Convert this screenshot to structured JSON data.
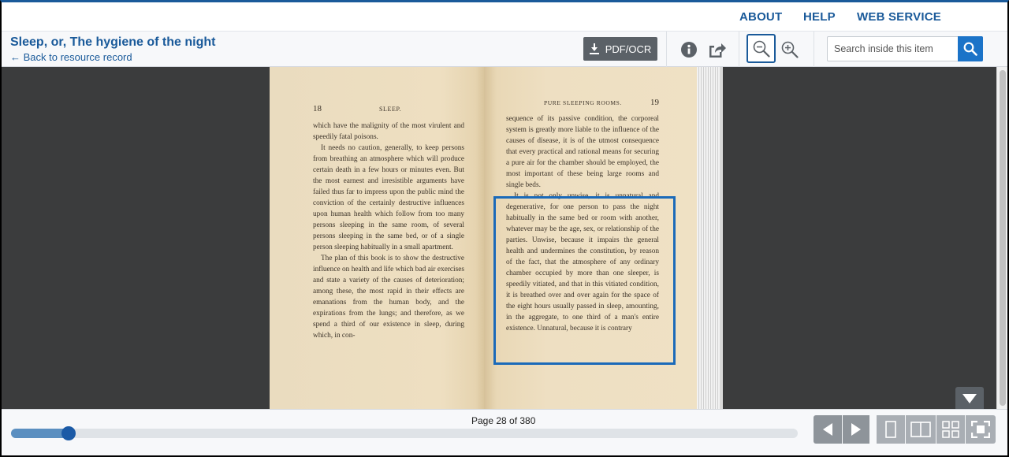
{
  "nav": {
    "about": "ABOUT",
    "help": "HELP",
    "web_service": "WEB SERVICE"
  },
  "header": {
    "title": "Sleep, or, The hygiene of the night",
    "back_link": "← Back to resource record",
    "pdf_button": "PDF/OCR",
    "search_placeholder": "Search inside this item"
  },
  "icons": {
    "download": "download-icon",
    "info": "info-icon",
    "share": "share-icon",
    "zoom_out": "zoom-out-icon",
    "zoom_in": "zoom-in-icon",
    "search": "search-icon",
    "collapse": "caret-down-icon",
    "prev": "arrow-left-icon",
    "next": "arrow-right-icon",
    "one_page": "single-page-view-icon",
    "two_page": "two-page-view-icon",
    "thumbnails": "thumbnail-view-icon",
    "fullscreen": "fullscreen-icon"
  },
  "book": {
    "left_page": {
      "number": "18",
      "header": "SLEEP.",
      "paragraphs": [
        "which have the malignity of the most virulent and speedily fatal poisons.",
        "It needs no caution, generally, to keep persons from breathing an atmosphere which will produce certain death in a few hours or minutes even. But the most earnest and irresistible arguments have failed thus far to impress upon the public mind the conviction of the certainly destructive influences upon human health which follow from too many persons sleeping in the same room, of several persons sleeping in the same bed, or of a single person sleeping habitually in a small apartment.",
        "The plan of this book is to show the destructive influence on health and life which bad air exercises and state a variety of the causes of deterioration; among these, the most rapid in their effects are emanations from the human body, and the expirations from the lungs; and therefore, as we spend a third of our existence in sleep, during which, in con-"
      ]
    },
    "right_page": {
      "number": "19",
      "header": "PURE SLEEPING ROOMS.",
      "paragraphs": [
        "sequence of its passive condition, the corporeal system is greatly more liable to the influence of the causes of disease, it is of the utmost consequence that every practical and rational means for securing a pure air for the chamber should be employed, the most important of these being large rooms and single beds.",
        "It is not only unwise, it is unnatural and degenerative, for one person to pass the night habitually in the same bed or room with another, whatever may be the age, sex, or relationship of the parties. Unwise, because it impairs the general health and undermines the constitution, by reason of the fact, that the atmosphere of any ordinary chamber occupied by more than one sleeper, is speedily vitiated, and that in this vitiated condition, it is breathed over and over again for the space of the eight hours usually passed in sleep, amounting, in the aggregate, to one third of a man's entire existence. Unnatural, because it is contrary"
      ]
    }
  },
  "footer": {
    "page_label": "Page 28 of 380",
    "current_page": 28,
    "total_pages": 380,
    "progress_fraction": 0.073
  }
}
